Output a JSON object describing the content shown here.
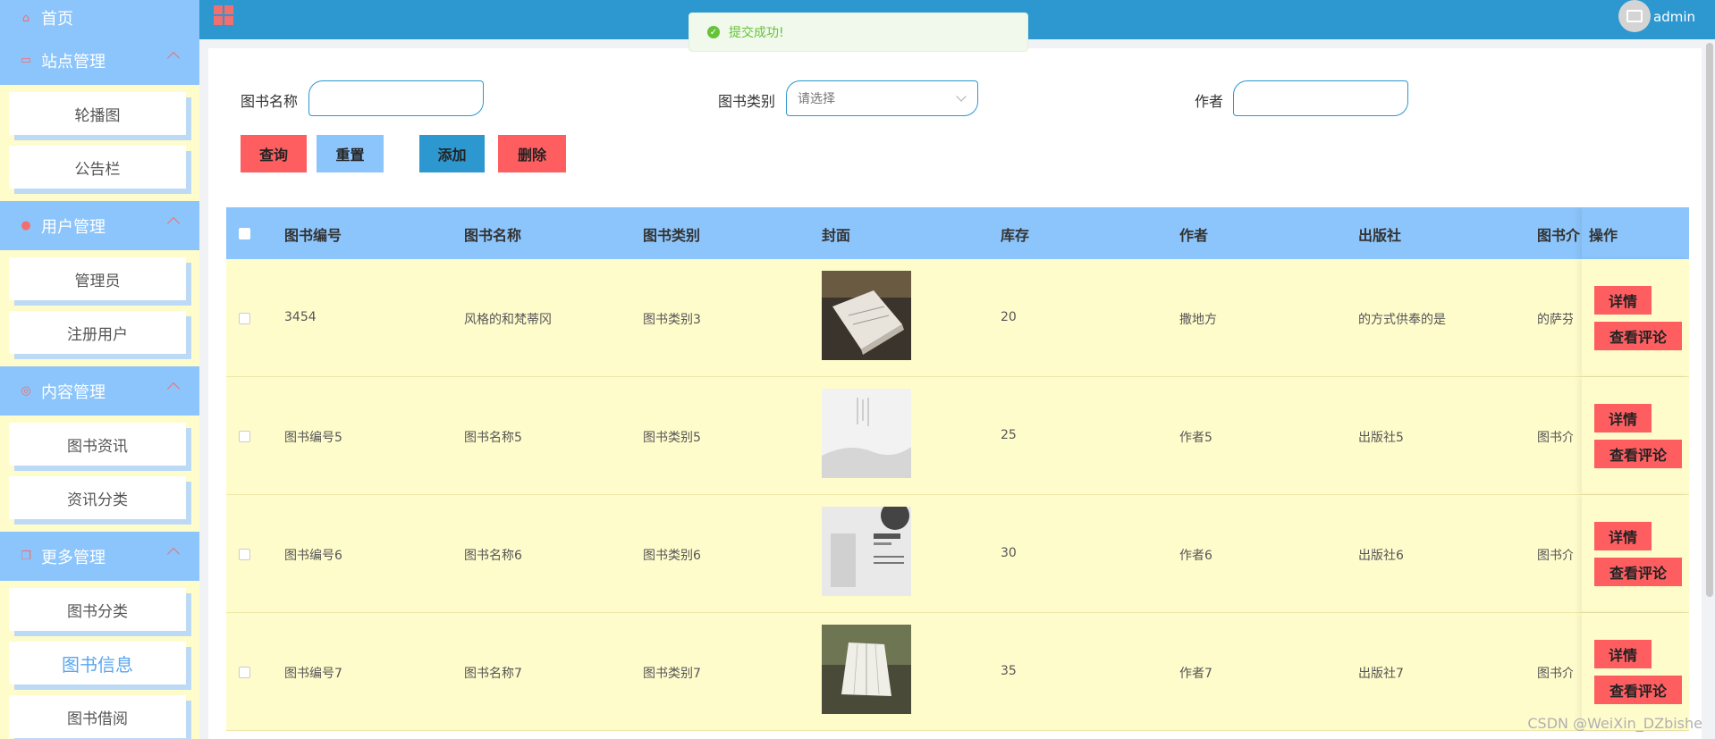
{
  "header": {
    "title": "",
    "username": "admin"
  },
  "toast": {
    "message": "提交成功!"
  },
  "sidebar": {
    "home": "首页",
    "groups": [
      {
        "label": "站点管理",
        "items": [
          "轮播图",
          "公告栏"
        ]
      },
      {
        "label": "用户管理",
        "items": [
          "管理员",
          "注册用户"
        ]
      },
      {
        "label": "内容管理",
        "items": [
          "图书资讯",
          "资讯分类"
        ]
      },
      {
        "label": "更多管理",
        "items": [
          "图书分类",
          "图书信息",
          "图书借阅"
        ]
      }
    ],
    "active_item": "图书信息"
  },
  "search": {
    "name_label": "图书名称",
    "name_value": "",
    "category_label": "图书类别",
    "category_placeholder": "请选择",
    "author_label": "作者",
    "author_value": ""
  },
  "buttons": {
    "query": "查询",
    "reset": "重置",
    "add": "添加",
    "delete": "删除"
  },
  "table": {
    "columns": [
      "图书编号",
      "图书名称",
      "图书类别",
      "封面",
      "库存",
      "作者",
      "出版社",
      "图书介",
      "操作"
    ],
    "rows": [
      {
        "id": "3454",
        "name": "风格的和梵蒂冈",
        "category": "图书类别3",
        "stock": "20",
        "author": "撒地方",
        "publisher": "的方式供奉的是",
        "intro": "的萨芬",
        "cover": "cover-1"
      },
      {
        "id": "图书编号5",
        "name": "图书名称5",
        "category": "图书类别5",
        "stock": "25",
        "author": "作者5",
        "publisher": "出版社5",
        "intro": "图书介绍",
        "cover": "cover-2"
      },
      {
        "id": "图书编号6",
        "name": "图书名称6",
        "category": "图书类别6",
        "stock": "30",
        "author": "作者6",
        "publisher": "出版社6",
        "intro": "图书介绍",
        "cover": "cover-3"
      },
      {
        "id": "图书编号7",
        "name": "图书名称7",
        "category": "图书类别7",
        "stock": "35",
        "author": "作者7",
        "publisher": "出版社7",
        "intro": "图书介绍",
        "cover": "cover-4"
      }
    ],
    "op_detail": "详情",
    "op_comments": "查看评论"
  },
  "watermark": "CSDN @WeiXin_DZbishe",
  "colors": {
    "header": "#2d97d0",
    "sidebar_group": "#8cc5fb",
    "row_bg": "#fffccc",
    "danger": "#ff5e61"
  }
}
